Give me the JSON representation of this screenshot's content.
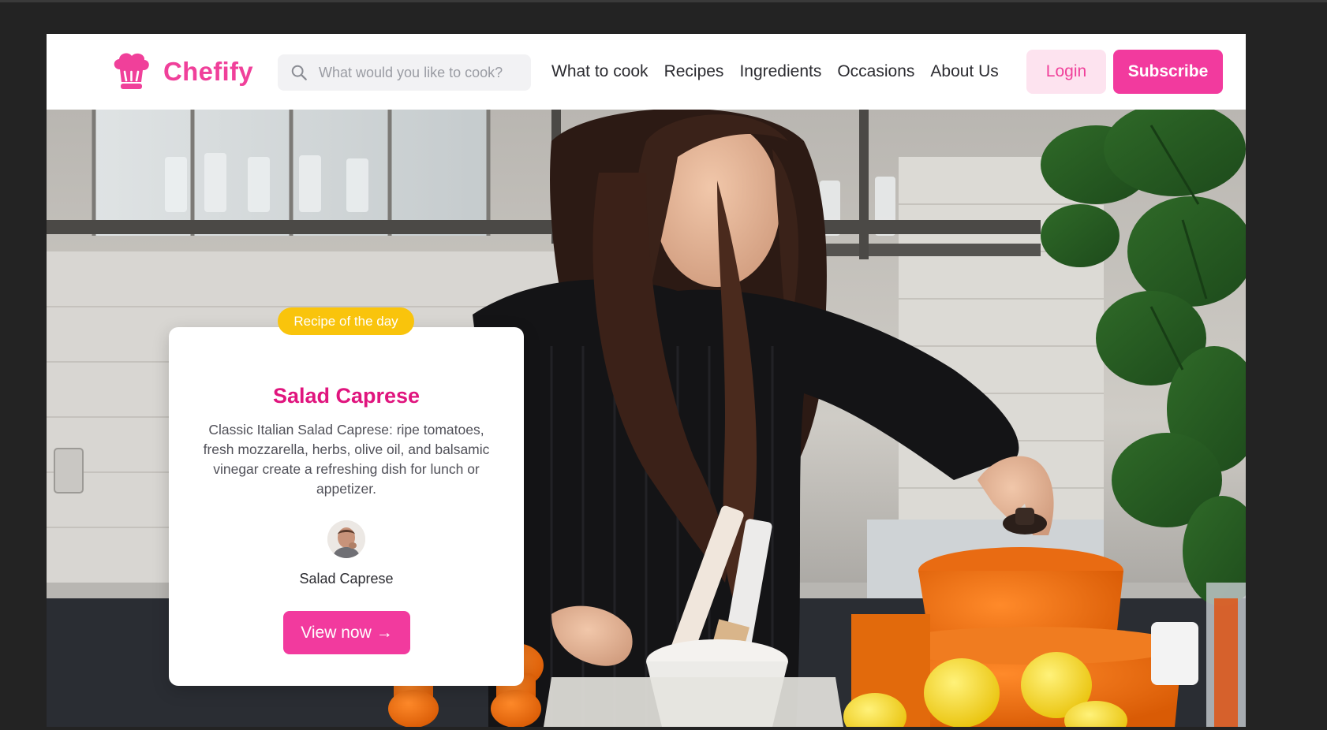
{
  "brand": {
    "name": "Chefify",
    "color": "#f0409a",
    "logo_icon": "chef-hat-icon"
  },
  "search": {
    "placeholder": "What would you like to cook?",
    "value": "",
    "icon": "search-icon"
  },
  "nav": {
    "items": [
      {
        "label": "What to cook"
      },
      {
        "label": "Recipes"
      },
      {
        "label": "Ingredients"
      },
      {
        "label": "Occasions"
      },
      {
        "label": "About Us"
      }
    ]
  },
  "actions": {
    "login_label": "Login",
    "subscribe_label": "Subscribe"
  },
  "colors": {
    "accent": "#f23a9e",
    "accent_soft": "#fde3ef",
    "badge": "#f9c40c",
    "title": "#e0157e"
  },
  "hero": {
    "image": "woman-cooking-in-kitchen"
  },
  "recipe_card": {
    "badge": "Recipe of the day",
    "title": "Salad Caprese",
    "description": "Classic Italian Salad Caprese: ripe tomatoes, fresh mozzarella, herbs, olive oil, and balsamic vinegar create a refreshing dish for lunch or appetizer.",
    "author": "Salad Caprese",
    "cta_label": "View now",
    "cta_arrow": "→"
  }
}
